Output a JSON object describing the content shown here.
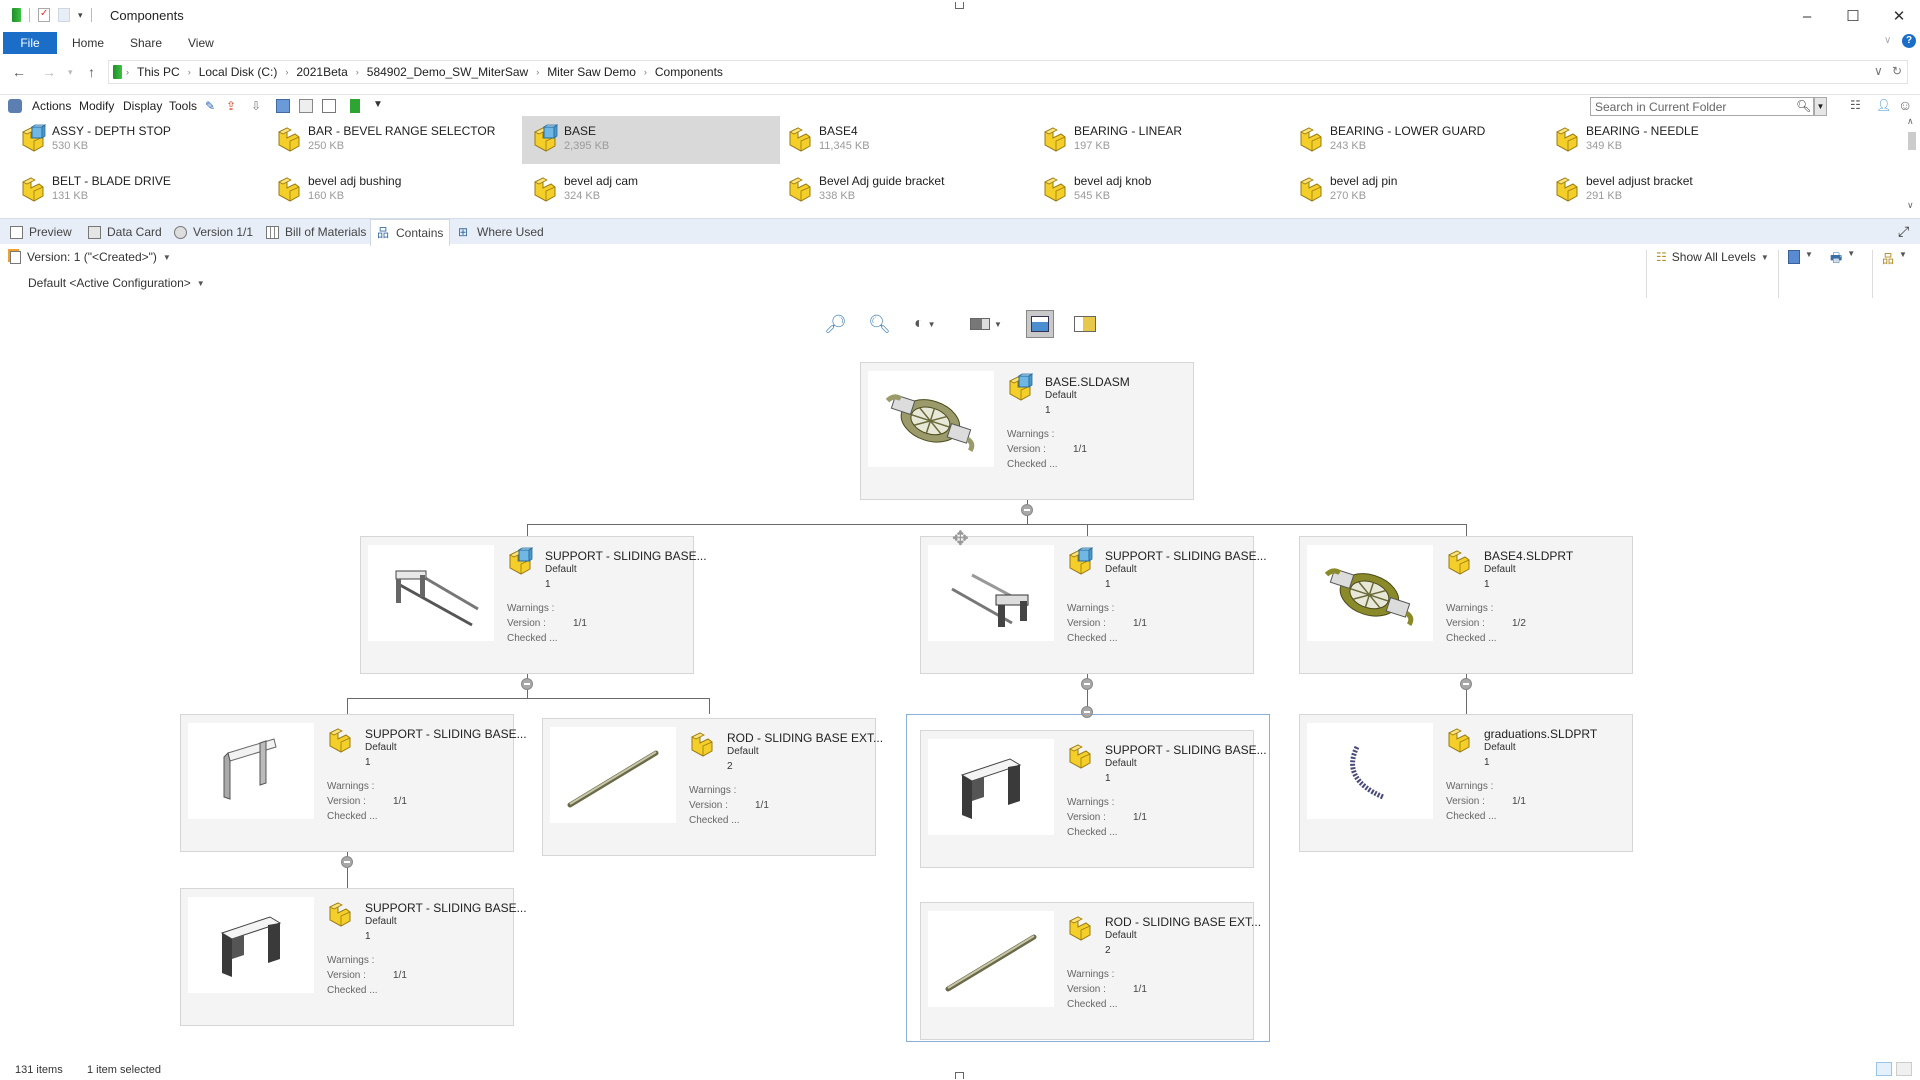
{
  "window": {
    "title": "Components",
    "controls": {
      "minimize": "–",
      "maximize": "☐",
      "close": "✕"
    }
  },
  "ribbon": {
    "tabs": [
      {
        "label": "File",
        "active": true
      },
      {
        "label": "Home"
      },
      {
        "label": "Share"
      },
      {
        "label": "View"
      }
    ],
    "accent_color": "#1a6ec7"
  },
  "address": {
    "breadcrumbs": [
      "This PC",
      "Local Disk (C:)",
      "2021Beta",
      "584902_Demo_SW_MiterSaw",
      "Miter Saw Demo",
      "Components"
    ]
  },
  "pdm_toolbar": {
    "menus": [
      "Actions",
      "Modify",
      "Display",
      "Tools"
    ],
    "search_placeholder": "Search in Current Folder"
  },
  "files": [
    {
      "name": "ASSY - DEPTH STOP",
      "size": "530 KB",
      "type": "assembly"
    },
    {
      "name": "BAR - BEVEL RANGE SELECTOR",
      "size": "250 KB",
      "type": "part"
    },
    {
      "name": "BASE",
      "size": "2,395 KB",
      "type": "assembly",
      "selected": true
    },
    {
      "name": "BASE4",
      "size": "11,345 KB",
      "type": "part"
    },
    {
      "name": "BEARING - LINEAR",
      "size": "197 KB",
      "type": "part"
    },
    {
      "name": "BEARING - LOWER GUARD",
      "size": "243 KB",
      "type": "part"
    },
    {
      "name": "BEARING - NEEDLE",
      "size": "349 KB",
      "type": "part"
    },
    {
      "name": "BELT - BLADE DRIVE",
      "size": "131 KB",
      "type": "part"
    },
    {
      "name": "bevel adj bushing",
      "size": "160 KB",
      "type": "part"
    },
    {
      "name": "bevel adj cam",
      "size": "324 KB",
      "type": "part"
    },
    {
      "name": "Bevel Adj guide bracket",
      "size": "338 KB",
      "type": "part"
    },
    {
      "name": "bevel adj knob",
      "size": "545 KB",
      "type": "part"
    },
    {
      "name": "bevel adj pin",
      "size": "270 KB",
      "type": "part"
    },
    {
      "name": "bevel adjust bracket",
      "size": "291 KB",
      "type": "part"
    }
  ],
  "tabs": [
    {
      "label": "Preview"
    },
    {
      "label": "Data Card"
    },
    {
      "label": "Version 1/1"
    },
    {
      "label": "Bill of Materials"
    },
    {
      "label": "Contains",
      "active": true
    },
    {
      "label": "Where Used"
    }
  ],
  "contains": {
    "version_label": "Version: 1 (\"<Created>\")",
    "configuration_label": "Default <Active Configuration>",
    "show_levels_label": "Show All Levels",
    "field_labels": {
      "warnings": "Warnings :",
      "version": "Version :",
      "checked": "Checked ..."
    },
    "nodes": [
      {
        "id": "root",
        "name": "BASE.SLDASM",
        "config": "Default",
        "qty": "1",
        "version": "1/1",
        "type": "assembly",
        "thumb": "base-assembly"
      },
      {
        "id": "n1",
        "name": "SUPPORT - SLIDING BASE...",
        "config": "Default",
        "qty": "1",
        "version": "1/1",
        "type": "assembly",
        "thumb": "support-rods-left"
      },
      {
        "id": "n2",
        "name": "SUPPORT - SLIDING BASE...",
        "config": "Default",
        "qty": "1",
        "version": "1/1",
        "type": "assembly",
        "thumb": "support-rods-right"
      },
      {
        "id": "n3",
        "name": "BASE4.SLDPRT",
        "config": "Default",
        "qty": "1",
        "version": "1/2",
        "type": "part",
        "thumb": "base-part"
      },
      {
        "id": "n4",
        "name": "SUPPORT - SLIDING BASE...",
        "config": "Default",
        "qty": "1",
        "version": "1/1",
        "type": "part",
        "thumb": "bracket-light"
      },
      {
        "id": "n5",
        "name": "ROD - SLIDING BASE EXT...",
        "config": "Default",
        "qty": "2",
        "version": "1/1",
        "type": "part",
        "thumb": "rod"
      },
      {
        "id": "n6",
        "name": "SUPPORT - SLIDING BASE...",
        "config": "Default",
        "qty": "1",
        "version": "1/1",
        "type": "part",
        "thumb": "bracket-dark"
      },
      {
        "id": "n7",
        "name": "graduations.SLDPRT",
        "config": "Default",
        "qty": "1",
        "version": "1/1",
        "type": "part",
        "thumb": "graduations"
      },
      {
        "id": "n8",
        "name": "SUPPORT - SLIDING BASE...",
        "config": "Default",
        "qty": "1",
        "version": "1/1",
        "type": "part",
        "thumb": "bracket-dark"
      },
      {
        "id": "n9",
        "name": "ROD - SLIDING BASE EXT...",
        "config": "Default",
        "qty": "2",
        "version": "1/1",
        "type": "part",
        "thumb": "rod"
      }
    ]
  },
  "status": {
    "item_count": "131 items",
    "selection": "1 item selected"
  }
}
